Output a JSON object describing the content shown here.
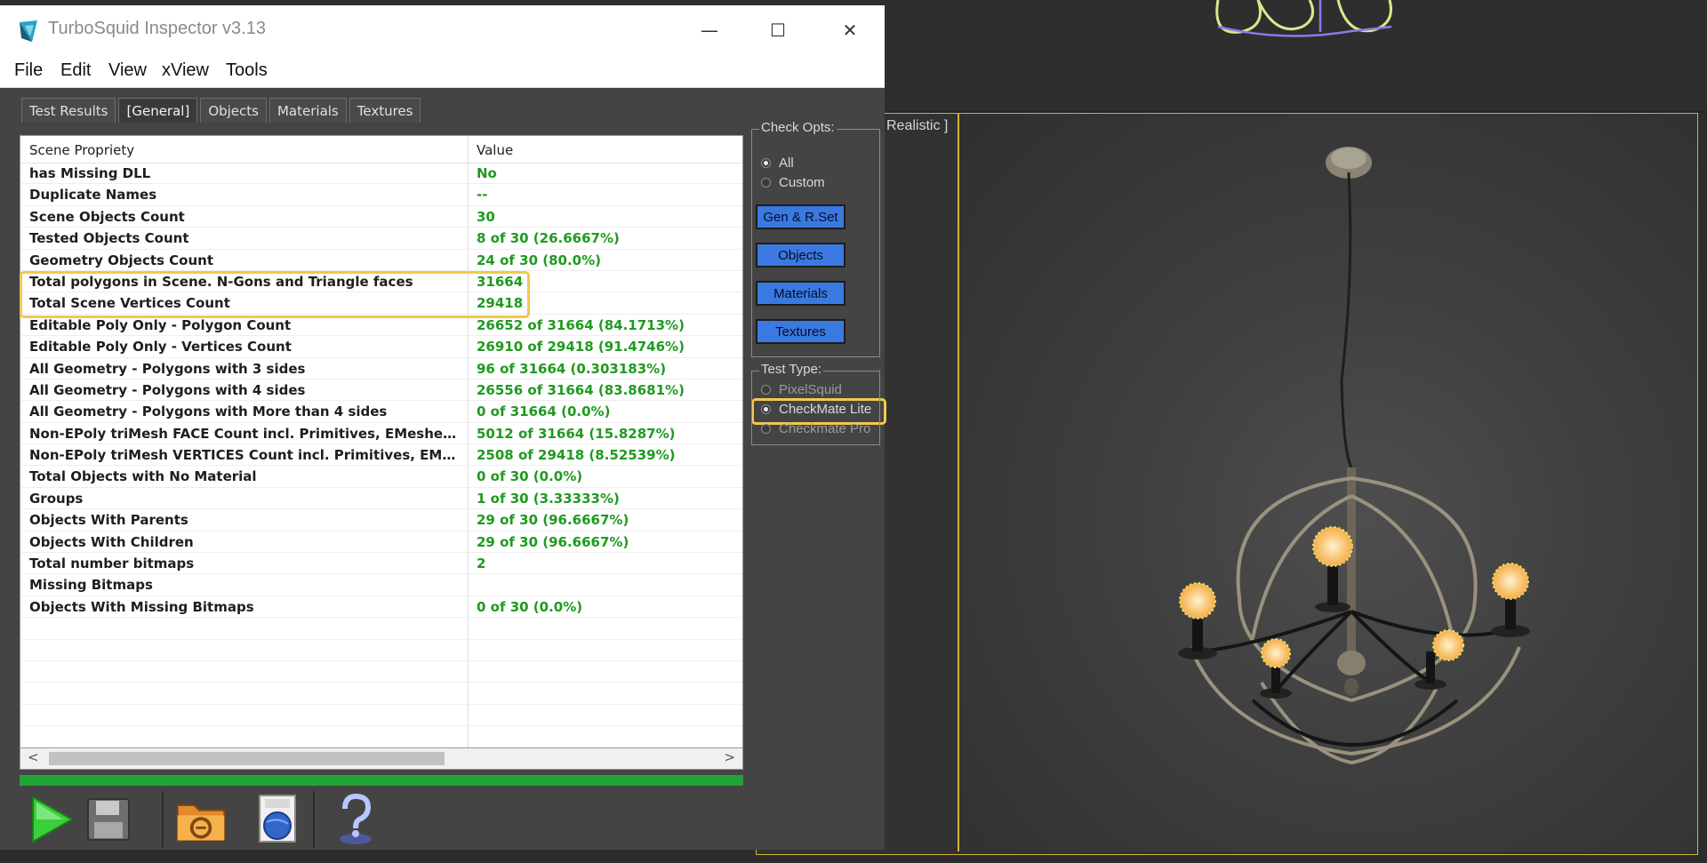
{
  "window": {
    "title": "TurboSquid Inspector v3.13",
    "minimize_glyph": "—",
    "maximize_glyph": "☐",
    "close_glyph": "✕"
  },
  "menu": [
    "File",
    "Edit",
    "View",
    "xView",
    "Tools"
  ],
  "tabs": [
    {
      "label": "Test Results",
      "active": false
    },
    {
      "label": "[General]",
      "active": true
    },
    {
      "label": "Objects",
      "active": false
    },
    {
      "label": "Materials",
      "active": false
    },
    {
      "label": "Textures",
      "active": false
    }
  ],
  "table": {
    "headers": {
      "property": "Scene Propriety",
      "value": "Value"
    },
    "rows": [
      {
        "property": "has Missing DLL",
        "value": "No"
      },
      {
        "property": "Duplicate Names",
        "value": "--"
      },
      {
        "property": "Scene Objects Count",
        "value": "30"
      },
      {
        "property": "Tested Objects Count",
        "value": "8 of 30 (26.6667%)"
      },
      {
        "property": "Geometry Objects Count",
        "value": "24 of 30 (80.0%)"
      },
      {
        "property": "Total polygons in Scene. N-Gons and Triangle faces",
        "value": "31664"
      },
      {
        "property": "Total Scene Vertices Count",
        "value": "29418"
      },
      {
        "property": "Editable Poly Only - Polygon Count",
        "value": "26652 of 31664 (84.1713%)"
      },
      {
        "property": "Editable Poly Only - Vertices Count",
        "value": "26910 of 29418 (91.4746%)"
      },
      {
        "property": "All Geometry - Polygons with 3 sides",
        "value": "96 of 31664 (0.303183%)"
      },
      {
        "property": "All Geometry - Polygons with 4 sides",
        "value": "26556 of 31664 (83.8681%)"
      },
      {
        "property": "All Geometry - Polygons with More than 4 sides",
        "value": "0 of 31664 (0.0%)"
      },
      {
        "property": "Non-EPoly triMesh FACE Count incl. Primitives, EMeshes etc...",
        "value": "5012 of 31664 (15.8287%)"
      },
      {
        "property": "Non-EPoly triMesh VERTICES Count incl. Primitives, EMeshes ...",
        "value": "2508 of 29418 (8.52539%)"
      },
      {
        "property": "Total Objects with No Material",
        "value": "0 of 30 (0.0%)"
      },
      {
        "property": "Groups",
        "value": "1 of 30 (3.33333%)"
      },
      {
        "property": "Objects With Parents",
        "value": "29 of 30 (96.6667%)"
      },
      {
        "property": "Objects With Children",
        "value": "29 of 30 (96.6667%)"
      },
      {
        "property": "Total number bitmaps",
        "value": "2"
      },
      {
        "property": "Missing Bitmaps",
        "value": ""
      },
      {
        "property": "Objects With Missing Bitmaps",
        "value": "0 of 30 (0.0%)"
      }
    ]
  },
  "scrollbar": {
    "left_arrow": "<",
    "right_arrow": ">"
  },
  "progress": {
    "fraction": 1.0
  },
  "check_opts": {
    "title": "Check Opts:",
    "options": [
      {
        "label": "All",
        "selected": true
      },
      {
        "label": "Custom",
        "selected": false
      }
    ],
    "buttons": [
      "Gen & R.Set",
      "Objects",
      "Materials",
      "Textures"
    ]
  },
  "test_type": {
    "title": "Test Type:",
    "options": [
      {
        "label": "PixelSquid",
        "selected": false
      },
      {
        "label": "CheckMate Lite",
        "selected": true
      },
      {
        "label": "Checkmate Pro",
        "selected": false
      }
    ]
  },
  "toolbar": {
    "icons": [
      "play-icon",
      "save-icon",
      "3ds-max-folder-icon",
      "html-globe-icon",
      "help-icon"
    ]
  },
  "viewport": {
    "label": "Realistic ]"
  },
  "colors": {
    "accent_highlight": "#f2c94c",
    "value_green": "#1f9a1f",
    "button_blue": "#3a7ae0",
    "progress_green": "#1fa531",
    "viewport_border": "#d1b42c"
  }
}
